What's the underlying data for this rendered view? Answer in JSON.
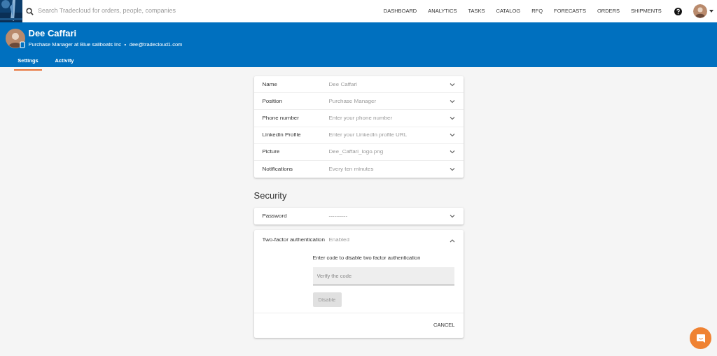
{
  "topbar": {
    "search": {
      "placeholder": "Search Tradecloud for orders, people, companies"
    },
    "nav": [
      "DASHBOARD",
      "ANALYTICS",
      "TASKS",
      "CATALOG",
      "RFQ",
      "FORECASTS",
      "ORDERS",
      "SHIPMENTS"
    ]
  },
  "profile_header": {
    "name": "Dee Caffari",
    "position": "Purchase Manager at Blue sailboats Inc",
    "separator": "•",
    "email": "dee@tradecloud1.com",
    "tabs": [
      {
        "label": "Settings",
        "selected": true
      },
      {
        "label": "Activity",
        "selected": false
      }
    ]
  },
  "profile_rows": [
    {
      "label": "Name",
      "value": "Dee Caffari",
      "expanded": false
    },
    {
      "label": "Position",
      "value": "Purchase Manager",
      "expanded": false
    },
    {
      "label": "Phone number",
      "value": "Enter your phone number",
      "expanded": false
    },
    {
      "label": "LinkedIn Profile",
      "value": "Enter your LinkedIn profile URL",
      "expanded": false
    },
    {
      "label": "Picture",
      "value": "Dee_Caffari_logo.png",
      "expanded": false
    },
    {
      "label": "Notifications",
      "value": "Every ten minutes",
      "expanded": false
    }
  ],
  "security": {
    "title": "Security",
    "password": {
      "label": "Password",
      "value": "----------",
      "expanded": false
    },
    "two_factor": {
      "label": "Two-factor authentication",
      "value": "Enabled",
      "expanded": true,
      "instruction": "Enter code to disable two factor authentication",
      "code_field": {
        "placeholder": "Verify the code"
      },
      "disable_button": {
        "label": "Disable",
        "disabled": true
      },
      "cancel_button": "CANCEL"
    }
  }
}
